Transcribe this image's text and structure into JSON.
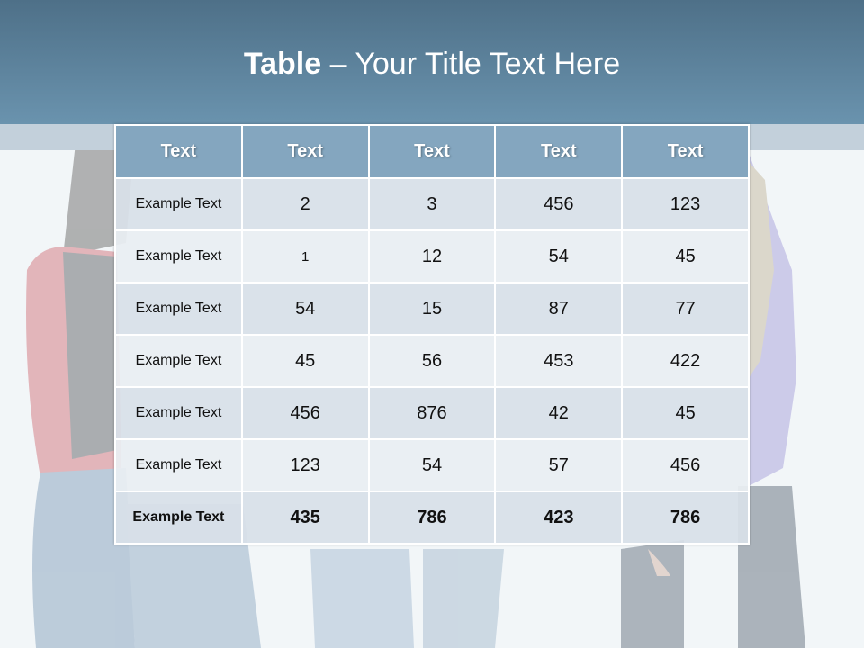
{
  "slide": {
    "title_bold": "Table",
    "title_rest": " – Your Title Text Here"
  },
  "table": {
    "headers": [
      "Text",
      "Text",
      "Text",
      "Text",
      "Text"
    ],
    "rows": [
      [
        "Example Text",
        "2",
        "3",
        "456",
        "123"
      ],
      [
        "Example Text",
        "1",
        "12",
        "54",
        "45"
      ],
      [
        "Example Text",
        "54",
        "15",
        "87",
        "77"
      ],
      [
        "Example Text",
        "45",
        "56",
        "453",
        "422"
      ],
      [
        "Example Text",
        "456",
        "876",
        "42",
        "45"
      ],
      [
        "Example Text",
        "123",
        "54",
        "57",
        "456"
      ],
      [
        "Example Text",
        "435",
        "786",
        "423",
        "786"
      ]
    ]
  },
  "colors": {
    "header_band": "#5f86a1",
    "table_header": "#84a6bf",
    "row_dark": "#d8e0e8",
    "row_light": "#e9eef2"
  }
}
